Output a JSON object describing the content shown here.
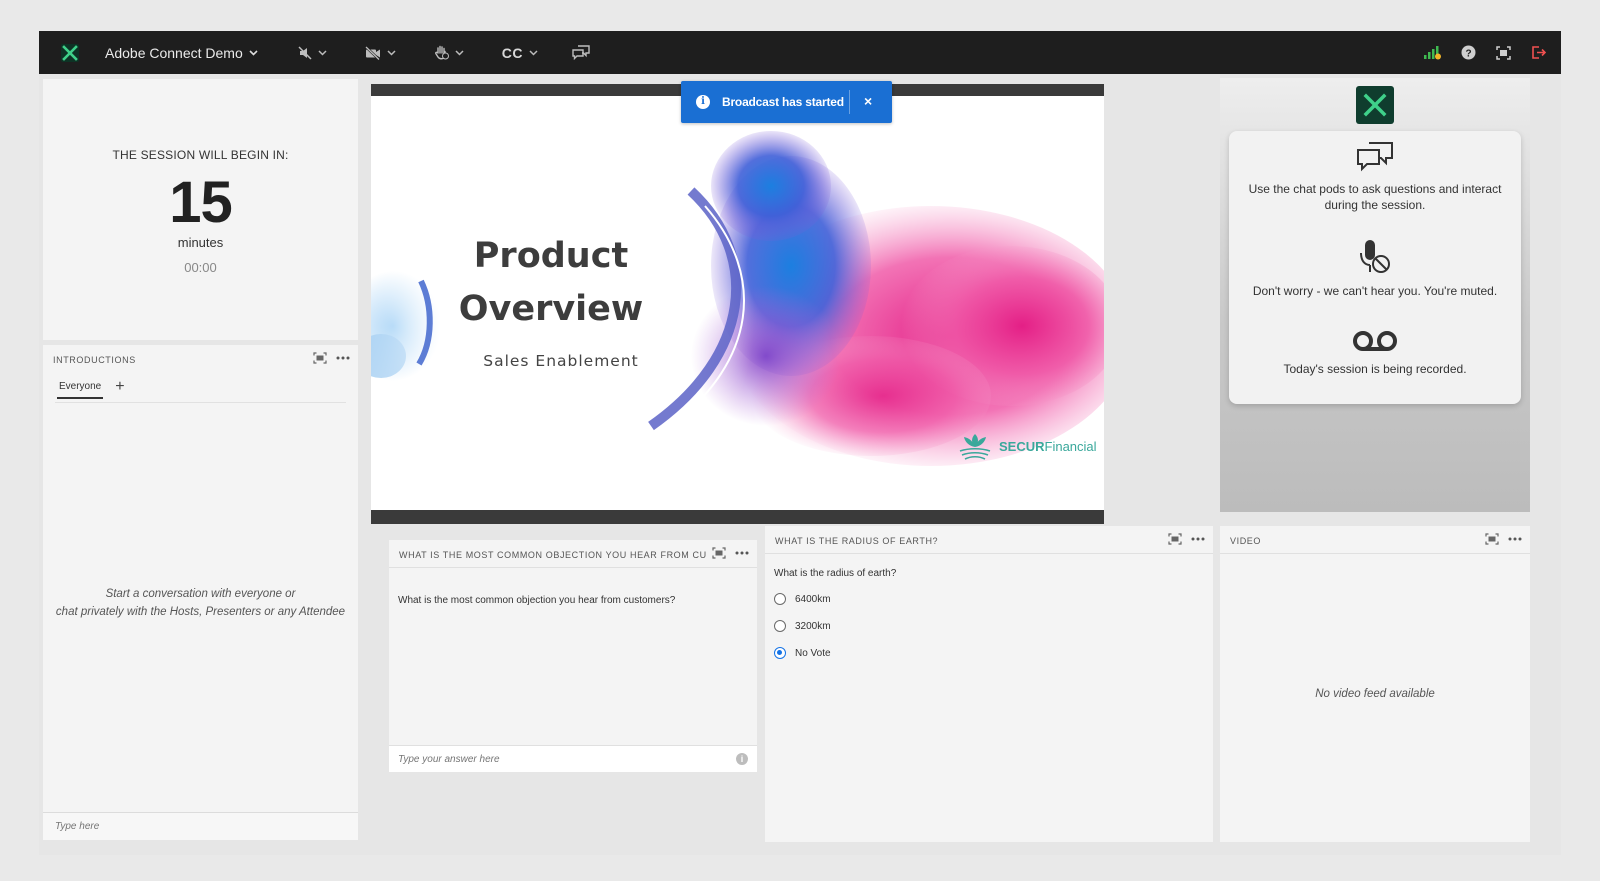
{
  "topbar": {
    "title": "Adobe Connect Demo",
    "controls": {
      "speaker_icon": "speaker-muted-icon",
      "camera_icon": "camera-off-icon",
      "raise_hand_icon": "raise-hand-icon",
      "captions_label": "CC",
      "chat_icon": "chat-bubbles-icon"
    },
    "right_icons": [
      "signal-strength-icon",
      "help-icon",
      "fullscreen-icon",
      "exit-icon"
    ]
  },
  "countdown": {
    "label": "THE SESSION WILL BEGIN IN:",
    "value": "15",
    "unit": "minutes",
    "timer": "00:00"
  },
  "chat": {
    "title": "INTRODUCTIONS",
    "tab": "Everyone",
    "add_tab": "+",
    "empty_line1": "Start a conversation with everyone or",
    "empty_line2": "chat privately with the Hosts, Presenters or any Attendee",
    "input_placeholder": "Type here"
  },
  "slide": {
    "title_line1": "Product",
    "title_line2": "Overview",
    "subtitle": "Sales Enablement",
    "brand_bold": "SECUR",
    "brand_light": "Financial"
  },
  "toast": {
    "message": "Broadcast has started",
    "close": "×"
  },
  "info_panel": {
    "items": [
      {
        "icon": "chat-icon",
        "text": "Use the chat pods to ask questions and interact during the session."
      },
      {
        "icon": "mic-muted-icon",
        "text": "Don't worry - we can't hear you. You're muted."
      },
      {
        "icon": "recording-icon",
        "text": "Today's session is being recorded."
      }
    ]
  },
  "question_pod": {
    "title": "WHAT IS THE MOST COMMON OBJECTION YOU HEAR FROM CUS...",
    "question": "What is the most common objection you hear from customers?",
    "answer_placeholder": "Type your answer here",
    "info_glyph": "i"
  },
  "poll_pod": {
    "title": "WHAT IS THE RADIUS OF EARTH?",
    "question": "What is the radius of earth?",
    "options": [
      {
        "label": "6400km",
        "selected": false
      },
      {
        "label": "3200km",
        "selected": false
      },
      {
        "label": "No Vote",
        "selected": true
      }
    ]
  },
  "video_pod": {
    "title": "VIDEO",
    "empty": "No video feed available"
  },
  "colors": {
    "topbar": "#1e1e1e",
    "accent": "#1a6fd3",
    "brand": "#3aa89b",
    "logo_bg": "#0f3d2e"
  }
}
